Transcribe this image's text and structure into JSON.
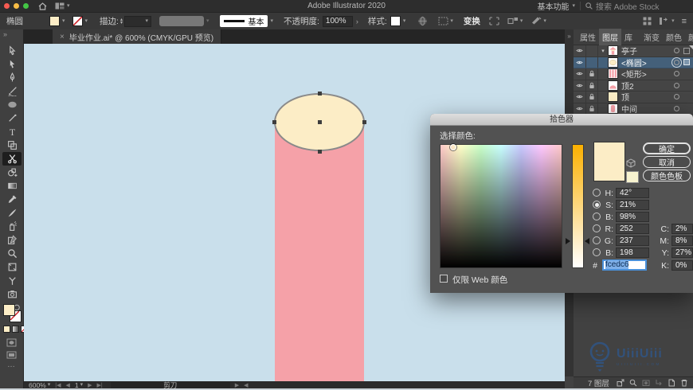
{
  "colors": {
    "canvas_bg": "#c9dfeb",
    "shape_pink": "#f5a1a8",
    "shape_cream": "#fcedc6",
    "selection_row": "#44607a",
    "watermark_blue": "#2f568a",
    "hue_top": "#fbb000"
  },
  "icons": {
    "chevron_down": "▾",
    "stepper_up": "▴",
    "stepper_down": "▾",
    "close": "×",
    "menu": "≡",
    "more": "…",
    "collapse": "»",
    "greater": "›",
    "prev": "◀",
    "next": "▶",
    "first": "|◀",
    "last": "▶|"
  },
  "menubar": {
    "title": "Adobe Illustrator 2020",
    "workspace": "基本功能",
    "search_placeholder": "搜索 Adobe Stock"
  },
  "controlbar": {
    "selection_label": "椭圆",
    "stroke_label": "描边:",
    "stroke_weight": "",
    "stroke_style": "基本",
    "opacity_label": "不透明度:",
    "opacity_value": "100%",
    "style_label": "样式:",
    "transform_label": "变换"
  },
  "document": {
    "tab_title": "毕业作业.ai* @ 600% (CMYK/GPU 预览)"
  },
  "toolbar_tools": [
    "direct-selection",
    "selection",
    "pen",
    "paintbrush",
    "ellipse",
    "line-segment",
    "type",
    "artboard",
    "scissors",
    "shape-builder",
    "gradient",
    "eyedropper",
    "knife",
    "symbol-sprayer",
    "slice",
    "zoom",
    "frame",
    "width"
  ],
  "color_picker": {
    "title": "拾色器",
    "select_label": "选择颜色:",
    "ok": "确定",
    "cancel": "取消",
    "swatches": "颜色色板",
    "web_only": "仅限 Web 颜色",
    "hsb": {
      "h_label": "H:",
      "h": "42°",
      "s_label": "S:",
      "s": "21%",
      "b_label": "B:",
      "b": "98%"
    },
    "rgb": {
      "r_label": "R:",
      "r": "252",
      "g_label": "G:",
      "g": "237",
      "b_label": "B:",
      "b": "198"
    },
    "hex_label": "#",
    "hex": "fcedc6",
    "cmyk": {
      "c_label": "C:",
      "c": "2%",
      "m_label": "M:",
      "m": "8%",
      "y_label": "Y:",
      "y": "27%",
      "k_label": "K:",
      "k": "0%"
    },
    "current_color": "#fcedc6"
  },
  "panel": {
    "tabs": [
      "属性",
      "图层",
      "库",
      "渐变",
      "颜色",
      "颜色参"
    ],
    "active_tab": "图层",
    "layers": [
      {
        "name": "亭子"
      },
      {
        "name": "<椭圆>"
      },
      {
        "name": "<矩形>"
      },
      {
        "name": "顶2"
      },
      {
        "name": "顶"
      },
      {
        "name": "中间"
      }
    ],
    "count_label": "7 图层"
  },
  "statusbar": {
    "zoom": "600%",
    "artboard": "1",
    "tool": "剪刀"
  },
  "watermark": {
    "text": "UiiiUiii",
    "subtext": "UIIIUIII.COM"
  }
}
